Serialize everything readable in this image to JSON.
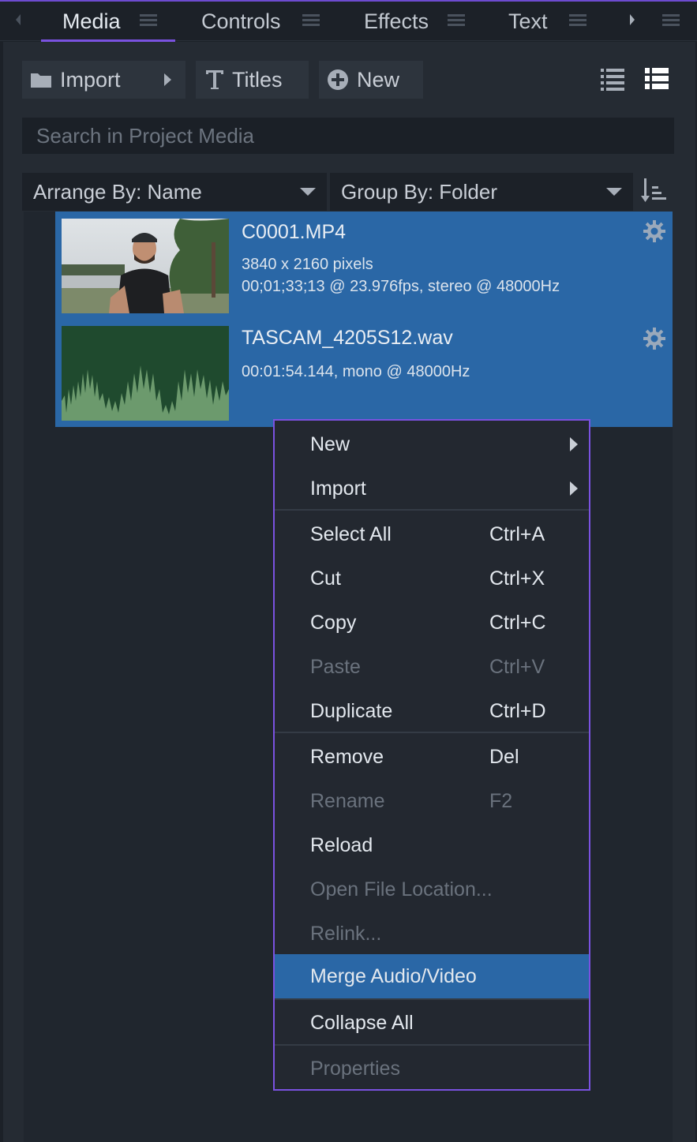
{
  "tabs": [
    {
      "label": "Media",
      "active": true
    },
    {
      "label": "Controls",
      "active": false
    },
    {
      "label": "Effects",
      "active": false
    },
    {
      "label": "Text",
      "active": false
    }
  ],
  "toolbar": {
    "import_label": "Import",
    "titles_label": "Titles",
    "new_label": "New"
  },
  "search": {
    "placeholder": "Search in Project Media",
    "value": ""
  },
  "arrange": {
    "arrange_label": "Arrange By: Name",
    "group_label": "Group By: Folder"
  },
  "media": [
    {
      "title": "C0001.MP4",
      "meta1": "3840 x 2160 pixels",
      "meta2": "00;01;33;13 @ 23.976fps, stereo @ 48000Hz"
    },
    {
      "title": "TASCAM_4205S12.wav",
      "meta1": "00:01:54.144, mono @ 48000Hz"
    }
  ],
  "menu": {
    "new": {
      "label": "New"
    },
    "import": {
      "label": "Import"
    },
    "select_all": {
      "label": "Select All",
      "shortcut": "Ctrl+A"
    },
    "cut": {
      "label": "Cut",
      "shortcut": "Ctrl+X"
    },
    "copy": {
      "label": "Copy",
      "shortcut": "Ctrl+C"
    },
    "paste": {
      "label": "Paste",
      "shortcut": "Ctrl+V"
    },
    "duplicate": {
      "label": "Duplicate",
      "shortcut": "Ctrl+D"
    },
    "remove": {
      "label": "Remove",
      "shortcut": "Del"
    },
    "rename": {
      "label": "Rename",
      "shortcut": "F2"
    },
    "reload": {
      "label": "Reload"
    },
    "open_location": {
      "label": "Open File Location..."
    },
    "relink": {
      "label": "Relink..."
    },
    "merge": {
      "label": "Merge Audio/Video"
    },
    "collapse": {
      "label": "Collapse All"
    },
    "properties": {
      "label": "Properties"
    }
  },
  "colors": {
    "accent": "#7a52e0",
    "selection": "#2a67a6",
    "panel": "#252b33"
  },
  "icons": [
    "chevron-left-icon",
    "hamburger-icon",
    "chevron-right-icon",
    "folder-icon",
    "text-t-icon",
    "plus-circle-icon",
    "list-view-icon",
    "detail-view-icon",
    "sort-icon",
    "gear-icon",
    "submenu-arrow-icon"
  ]
}
